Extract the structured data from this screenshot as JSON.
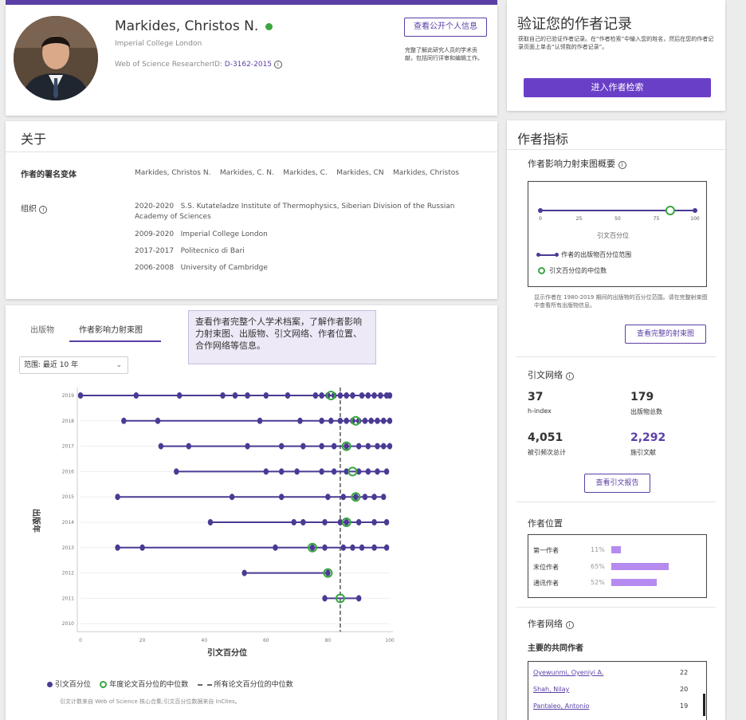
{
  "profile": {
    "name": "Markides, Christos N.",
    "affiliation": "Imperial College London",
    "researcher_id_label": "Web of Science ResearcherID:",
    "researcher_id": "D-3162-2015",
    "public_button": "查看公开个人信息",
    "public_desc": "完整了解此研究人员的学术贡献，包括同行评审和编辑工作。"
  },
  "verify": {
    "title": "验证您的作者记录",
    "desc": "获取自己的已验证作者记录。在“作者检索”中输入您的姓名，然后在您的作者记录页面上单击“认领我的作者记录”。",
    "button": "进入作者检索"
  },
  "about": {
    "title": "关于",
    "name_variants_label": "作者的署名变体",
    "name_variants": "Markides, Christos N.    Markides, C. N.    Markides, C.    Markides, CN    Markides, Christos",
    "org_label": "组织",
    "orgs": [
      {
        "years": "2020-2020",
        "name": "S.S. Kutateladze Institute of Thermophysics, Siberian Division of the Russian Academy of Sciences"
      },
      {
        "years": "2009-2020",
        "name": "Imperial College London"
      },
      {
        "years": "2017-2017",
        "name": "Politecnico di Bari"
      },
      {
        "years": "2006-2008",
        "name": "University of Cambridge"
      }
    ]
  },
  "tabs": {
    "publications": "出版物",
    "impact": "作者影响力射束图"
  },
  "callout": "查看作者完整个人学术档案，了解作者影响力射束图、出版物、引文网络、作者位置、合作网络等信息。",
  "range_select": "范围: 最近 10 年",
  "chart_data": {
    "type": "scatter",
    "title": "",
    "xlabel": "引文百分位",
    "ylabel": "出版年",
    "xlim": [
      0,
      100
    ],
    "x_ticks": [
      "0",
      "20",
      "40",
      "60",
      "80",
      "100"
    ],
    "years": [
      "2019",
      "2018",
      "2017",
      "2016",
      "2015",
      "2014",
      "2013",
      "2012",
      "2011",
      "2010"
    ],
    "series": [
      {
        "year": "2019",
        "points": [
          0,
          18,
          32,
          46,
          50,
          54,
          60,
          67,
          76,
          78,
          80,
          82,
          84,
          86,
          88,
          91,
          93,
          95,
          97,
          99,
          100
        ],
        "median": 81
      },
      {
        "year": "2018",
        "points": [
          14,
          25,
          58,
          71,
          78,
          81,
          84,
          86,
          88,
          90,
          92,
          94,
          96,
          98,
          100
        ],
        "median": 89
      },
      {
        "year": "2017",
        "points": [
          26,
          35,
          54,
          65,
          72,
          78,
          82,
          86,
          90,
          93,
          96,
          98,
          100
        ],
        "median": 86
      },
      {
        "year": "2016",
        "points": [
          31,
          60,
          65,
          70,
          78,
          82,
          86,
          90,
          93,
          96,
          99
        ],
        "median": 88
      },
      {
        "year": "2015",
        "points": [
          12,
          49,
          65,
          80,
          85,
          89,
          92,
          95,
          98
        ],
        "median": 89
      },
      {
        "year": "2014",
        "points": [
          42,
          69,
          72,
          79,
          84,
          86,
          90,
          95,
          99
        ],
        "median": 86
      },
      {
        "year": "2013",
        "points": [
          12,
          20,
          63,
          75,
          79,
          85,
          88,
          91,
          95,
          99
        ],
        "median": 75
      },
      {
        "year": "2012",
        "points": [
          53,
          80
        ],
        "median": 80
      },
      {
        "year": "2011",
        "points": [
          79,
          90
        ],
        "median": 84
      },
      {
        "year": "2010",
        "points": [],
        "median": null
      }
    ],
    "all_median": 84,
    "legend": {
      "dot": "引文百分位",
      "median": "年度论文百分位的中位数",
      "all": "所有论文百分位的中位数"
    }
  },
  "chart_footnote": "引文计数来自 Web of Science 核心合集;引文百分位数据来自 InCites。",
  "metrics": {
    "title": "作者指标",
    "impact_overview": "作者影响力射束图概要",
    "mini_ticks": [
      "0",
      "25",
      "50",
      "75",
      "100"
    ],
    "mini_xlabel": "引文百分位",
    "mini_legend_range": "作者的出版物百分位范围",
    "mini_legend_median": "引文百分位的中位数",
    "mini_range": [
      0,
      100
    ],
    "mini_median": 84,
    "mini_desc": "显示作者在 1980-2019 期间的出版物的百分位范围。请在完整射束图中查看所有出版物信息。",
    "full_chart_button": "查看完整的射束图",
    "citation_network": "引文网络",
    "h_index_value": "37",
    "h_index_label": "h-index",
    "pubs_value": "179",
    "pubs_label": "出版物总数",
    "times_cited_value": "4,051",
    "times_cited_label": "被引频次总计",
    "citing_value": "2,292",
    "citing_label": "施引文献",
    "report_button": "查看引文报告",
    "position_title": "作者位置",
    "positions": [
      {
        "label": "第一作者",
        "pct": "11%",
        "value": 0.11
      },
      {
        "label": "末位作者",
        "pct": "65%",
        "value": 0.65
      },
      {
        "label": "通讯作者",
        "pct": "52%",
        "value": 0.52
      }
    ],
    "coauthor_network": "作者网络",
    "top_coauthors": "主要的共同作者",
    "coauthors": [
      {
        "name": "Oyewunmi, Oyeniyi A.",
        "count": "22"
      },
      {
        "name": "Shah, Nilay",
        "count": "20"
      },
      {
        "name": "Pantaleo, Antonio",
        "count": "19"
      }
    ]
  },
  "colors": {
    "accent": "#5b3fa6",
    "dot": "#4b3a94",
    "median": "#3aa641",
    "bar": "#b58bf0"
  }
}
